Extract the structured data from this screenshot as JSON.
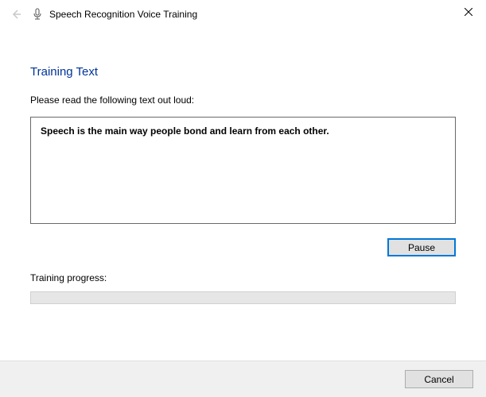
{
  "window": {
    "title": "Speech Recognition Voice Training"
  },
  "heading": "Training Text",
  "instruction": "Please read the following text out loud:",
  "training_text": "Speech is the main way people bond and learn from each other.",
  "buttons": {
    "pause": "Pause",
    "cancel": "Cancel"
  },
  "progress": {
    "label": "Training progress:"
  }
}
